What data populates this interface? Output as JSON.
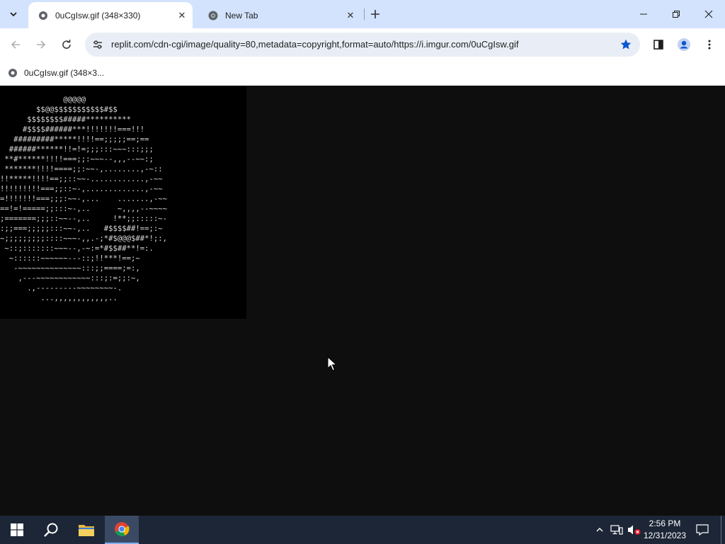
{
  "browser": {
    "tabs": [
      {
        "title": "0uCgIsw.gif (348×330)",
        "active": true
      },
      {
        "title": "New Tab",
        "active": false
      }
    ],
    "url": "replit.com/cdn-cgi/image/quality=80,metadata=copyright,format=auto/https://i.imgur.com/0uCgIsw.gif",
    "bookmarks": [
      {
        "label": "0uCgIsw.gif (348×3..."
      }
    ]
  },
  "content": {
    "ascii_art": "              @@@@@\n        $$@@$$$$$$$$$$$#$$\n      $$$$$$$$#####**********\n     #$$$$######***!!!!!!!===!!!\n   #########*****!!!!==;;;;;==;==\n  ######******!!=!=;;;:::~~~:::;;;\n **#******!!!!===;;:~~~--,,,--~~:;\n *******!!!!====;;:~~-,........,-~::\n!!*****!!!!==;;::~~-............,-~~\n!!!!!!!!!===;;::~-,.............,-~~\n=!!!!!!!===;;;:~~-,...    .......,-~~\n==!=!=====;;:::~-,..      ~,,,,--~~~~\n;=======;;;::~~--,..     !**;;:::::~-\n:;;===;;;;;:::~~-,..   #$$$$##!==;:~\n~;;;;;;;;;::::~~~-,,.-;*#$@@@$##*!;:,\n ~::;:::::::~~~--,-~:=*#$$##**!=:.\n  ~::::::~~~~~~---::;!!***!==;~\n   -~~~~~~~~~~~~~~:::;;====;=:,\n    ,---~~~~~~~~~~~~:::;:=;;:~,\n      .,---------~~~~~~~~-.\n         ...,,,,,,,,,,,,.."
  },
  "taskbar": {
    "time": "2:56 PM",
    "date": "12/31/2023"
  }
}
